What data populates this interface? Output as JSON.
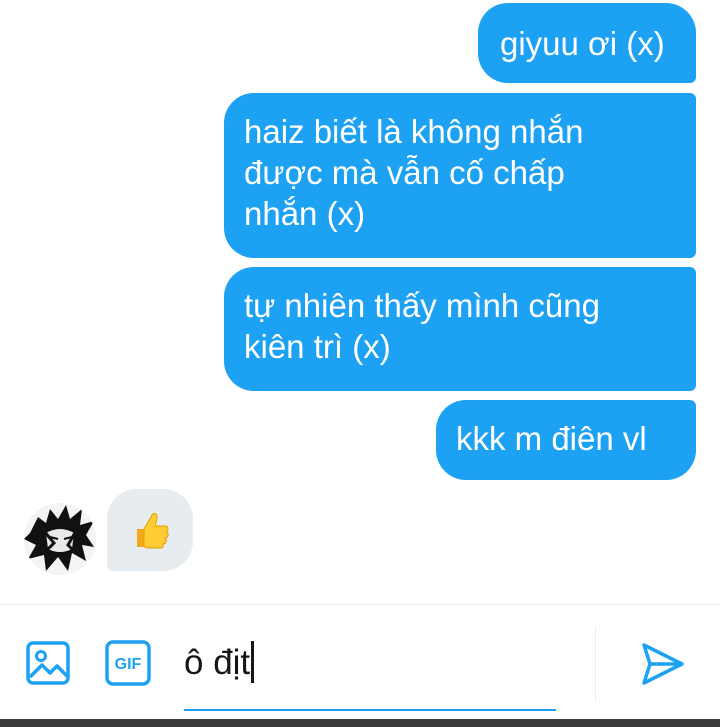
{
  "messages": {
    "outgoing": [
      {
        "lines": [
          "giyuu ơi (x)"
        ]
      },
      {
        "lines": [
          "haiz biết là không nhắn",
          "được mà vẫn cố chấp",
          "nhắn (x)"
        ]
      },
      {
        "lines": [
          "tự nhiên thấy mình cũng",
          "kiên trì (x)"
        ]
      },
      {
        "lines": [
          "kkk m điên vl"
        ]
      }
    ],
    "incoming": [
      {
        "emoji": "👍",
        "icon": "thumbs-up-icon"
      }
    ]
  },
  "composer": {
    "input_value": "ô địt",
    "gif_label": "GIF",
    "image_icon": "image-icon",
    "gif_icon": "gif-icon",
    "send_icon": "send-icon"
  },
  "colors": {
    "accent": "#1da1f2",
    "incoming_bubble": "#e6ecf0",
    "text": "#14171a",
    "outgoing_text": "#ffffff"
  }
}
